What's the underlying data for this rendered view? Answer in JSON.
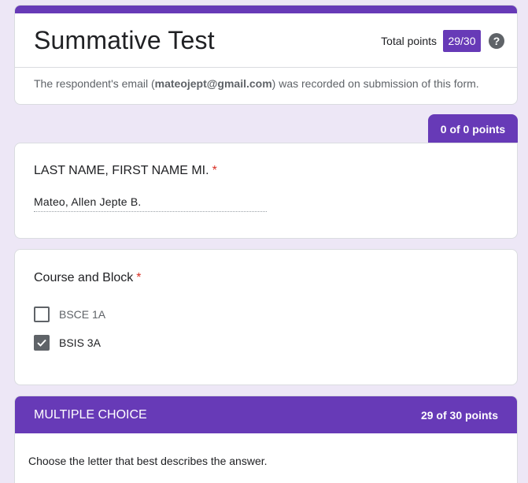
{
  "header": {
    "title": "Summative Test",
    "total_points_label": "Total points",
    "total_points_value": "29/30",
    "help_glyph": "?",
    "email_prefix": "The respondent's email (",
    "email": "mateojept@gmail.com",
    "email_suffix": ") was recorded on submission of this form."
  },
  "points_tab": "0 of 0 points",
  "name_question": {
    "title": "LAST NAME, FIRST NAME MI.",
    "required_mark": "*",
    "answer": "Mateo, Allen Jepte B."
  },
  "course_question": {
    "title": "Course and Block",
    "required_mark": "*",
    "options": [
      {
        "label": "BSCE 1A",
        "checked": false
      },
      {
        "label": "BSIS 3A",
        "checked": true
      }
    ]
  },
  "section": {
    "title": "MULTIPLE CHOICE",
    "points": "29 of 30 points",
    "description": "Choose the letter that best describes the answer."
  },
  "colors": {
    "accent": "#673ab7",
    "background": "#ede7f6",
    "required": "#d93025"
  }
}
